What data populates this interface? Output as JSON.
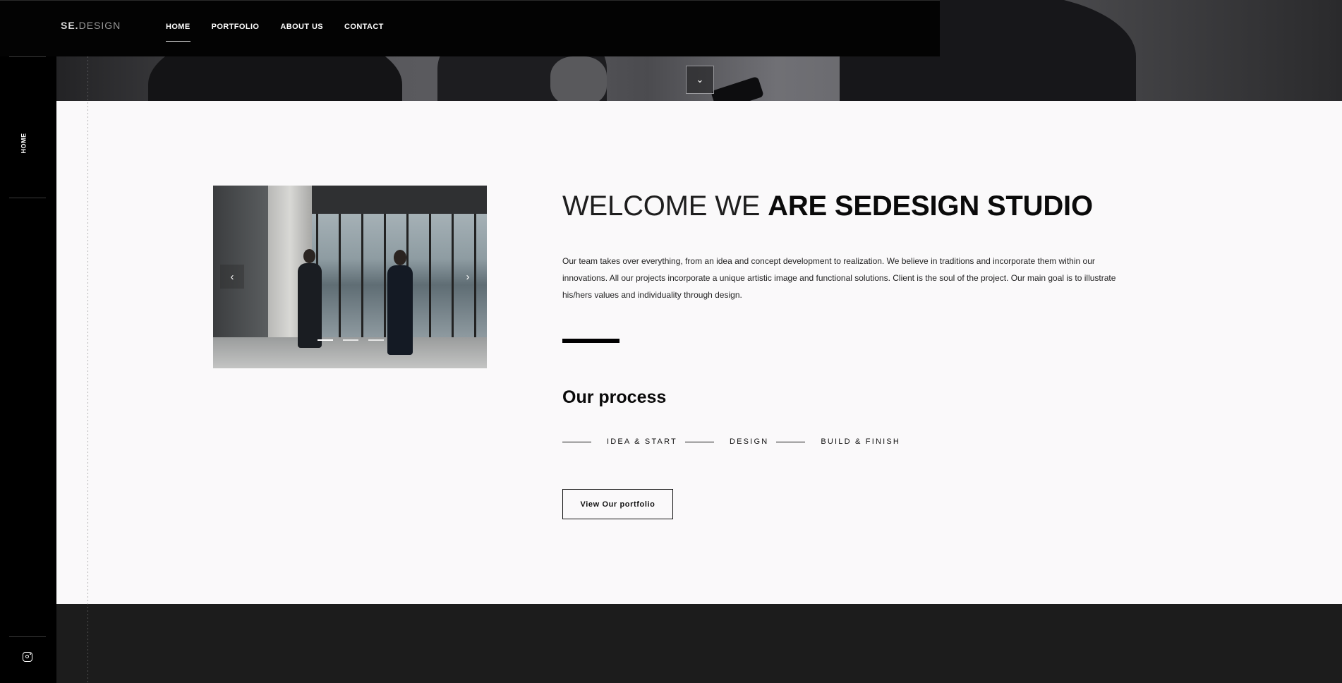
{
  "header": {
    "logo_prefix": "SE.",
    "logo_suffix": "DESIGN",
    "nav": [
      {
        "label": "HOME"
      },
      {
        "label": "PORTFOLIO"
      },
      {
        "label": "ABOUT US"
      },
      {
        "label": "CONTACT"
      }
    ],
    "active_nav": "HOME"
  },
  "sidebar": {
    "page_label": "HOME",
    "social_icon": "instagram-icon"
  },
  "hero": {
    "scroll_icon": "chevron-down-icon",
    "scroll_glyph": "⌄"
  },
  "carousel": {
    "prev_glyph": "‹",
    "next_glyph": "›",
    "slide_count": 3,
    "active_slide": 1
  },
  "welcome": {
    "heading_light": "WELCOME WE ",
    "heading_bold": "ARE SEDESIGN STUDIO",
    "intro": "Our team takes over everything, from an idea and concept development to realization. We believe in traditions and incorporate them within our innovations. All our projects incorporate a unique artistic image and functional solutions. Client is the soul of the project. Our main goal is to illustrate his/hers values and individuality through design."
  },
  "process": {
    "title": "Our process",
    "steps": [
      "IDEA & START",
      "DESIGN",
      "BUILD & FINISH"
    ]
  },
  "cta": {
    "label": "View Our portfolio"
  },
  "colors": {
    "header_bg": "#030303",
    "sidebar_bg": "#000000",
    "content_bg": "#faf9fa",
    "footer_bg": "#1c1c1c",
    "text": "#0a0a0a"
  }
}
